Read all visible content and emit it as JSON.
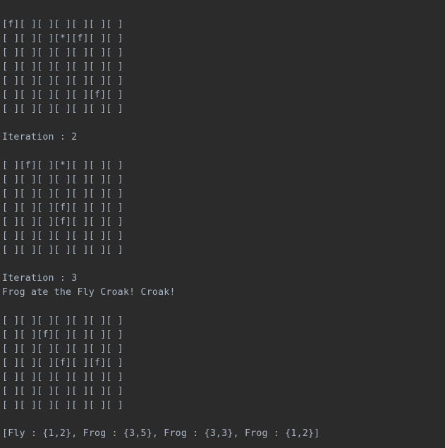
{
  "console": {
    "background_color": "#2b2b2b",
    "text_color": "#a9b7c6",
    "grid_rows": 7,
    "grid_cols": 7,
    "empty_cell": "[ ]",
    "fly_cell": "[f]",
    "frog_cell": "[*]",
    "lines": [
      {
        "type": "grid",
        "text": "[f][ ][ ][ ][ ][ ][ ]"
      },
      {
        "type": "grid",
        "text": "[ ][ ][ ][*][f][ ][ ]"
      },
      {
        "type": "grid",
        "text": "[ ][ ][ ][ ][ ][ ][ ]"
      },
      {
        "type": "grid",
        "text": "[ ][ ][ ][ ][ ][ ][ ]"
      },
      {
        "type": "grid",
        "text": "[ ][ ][ ][ ][ ][ ][ ]"
      },
      {
        "type": "grid",
        "text": "[ ][ ][ ][ ][ ][f][ ]"
      },
      {
        "type": "grid",
        "text": "[ ][ ][ ][ ][ ][ ][ ]"
      },
      {
        "type": "blank",
        "text": ""
      },
      {
        "type": "iter",
        "text": "Iteration : 2"
      },
      {
        "type": "blank",
        "text": ""
      },
      {
        "type": "grid",
        "text": "[ ][f][ ][*][ ][ ][ ]"
      },
      {
        "type": "grid",
        "text": "[ ][ ][ ][ ][ ][ ][ ]"
      },
      {
        "type": "grid",
        "text": "[ ][ ][ ][ ][ ][ ][ ]"
      },
      {
        "type": "grid",
        "text": "[ ][ ][ ][f][ ][ ][ ]"
      },
      {
        "type": "grid",
        "text": "[ ][ ][ ][f][ ][ ][ ]"
      },
      {
        "type": "grid",
        "text": "[ ][ ][ ][ ][ ][ ][ ]"
      },
      {
        "type": "grid",
        "text": "[ ][ ][ ][ ][ ][ ][ ]"
      },
      {
        "type": "blank",
        "text": ""
      },
      {
        "type": "iter",
        "text": "Iteration : 3"
      },
      {
        "type": "msg",
        "text": "Frog ate the Fly Croak! Croak!"
      },
      {
        "type": "blank",
        "text": ""
      },
      {
        "type": "grid",
        "text": "[ ][ ][ ][ ][ ][ ][ ]"
      },
      {
        "type": "grid",
        "text": "[ ][ ][f][ ][ ][ ][ ]"
      },
      {
        "type": "grid",
        "text": "[ ][ ][ ][ ][ ][ ][ ]"
      },
      {
        "type": "grid",
        "text": "[ ][ ][ ][f][ ][f][ ]"
      },
      {
        "type": "grid",
        "text": "[ ][ ][ ][ ][ ][ ][ ]"
      },
      {
        "type": "grid",
        "text": "[ ][ ][ ][ ][ ][ ][ ]"
      },
      {
        "type": "grid",
        "text": "[ ][ ][ ][ ][ ][ ][ ]"
      },
      {
        "type": "blank",
        "text": ""
      },
      {
        "type": "final",
        "text": "[Fly : {1,2}, Frog : {3,5}, Frog : {3,3}, Frog : {1,2}]"
      }
    ],
    "entities": [
      {
        "kind": "Fly",
        "position": "{1,2}"
      },
      {
        "kind": "Frog",
        "position": "{3,5}"
      },
      {
        "kind": "Frog",
        "position": "{3,3}"
      },
      {
        "kind": "Frog",
        "position": "{1,2}"
      }
    ],
    "iterations": [
      "2",
      "3"
    ],
    "messages": [
      "Frog ate the Fly Croak! Croak!"
    ]
  }
}
